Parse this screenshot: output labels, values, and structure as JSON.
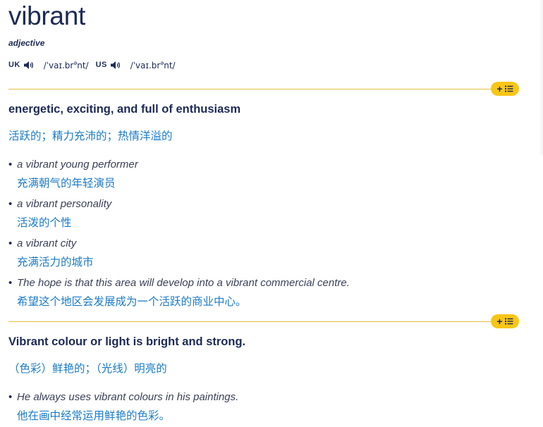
{
  "entry": {
    "headword": "vibrant",
    "part_of_speech": "adjective",
    "pronunciations": {
      "uk": {
        "label": "UK",
        "ipa_pre": "/ˈvaɪ.br",
        "ipa_sup": "ə",
        "ipa_post": "nt/"
      },
      "us": {
        "label": "US",
        "ipa_pre": "/ˈvaɪ.br",
        "ipa_sup": "ə",
        "ipa_post": "nt/"
      }
    },
    "senses": [
      {
        "definition": "energetic, exciting, and full of enthusiasm",
        "translation": "活跃的；精力充沛的；热情洋溢的",
        "examples": [
          {
            "en": "a vibrant young performer",
            "zh": "充满朝气的年轻演员"
          },
          {
            "en": "a vibrant personality",
            "zh": "活泼的个性"
          },
          {
            "en": "a vibrant city",
            "zh": "充满活力的城市"
          },
          {
            "en": "The hope is that this area will develop into a vibrant commercial centre.",
            "zh": "希望这个地区会发展成为一个活跃的商业中心。"
          }
        ]
      },
      {
        "definition": "Vibrant colour or light is bright and strong.",
        "translation": "（色彩）鲜艳的；（光线）明亮的",
        "examples": [
          {
            "en": "He always uses vibrant colours in his paintings.",
            "zh": "他在画中经常运用鲜艳的色彩。"
          }
        ]
      }
    ]
  },
  "icons": {
    "speaker": "speaker-icon",
    "add_to_list": "add-to-word-list-icon"
  },
  "colors": {
    "headword": "#1d2a57",
    "translation": "#1a7bc9",
    "accent_pill": "#f8c616",
    "rule": "#e3c03a"
  }
}
